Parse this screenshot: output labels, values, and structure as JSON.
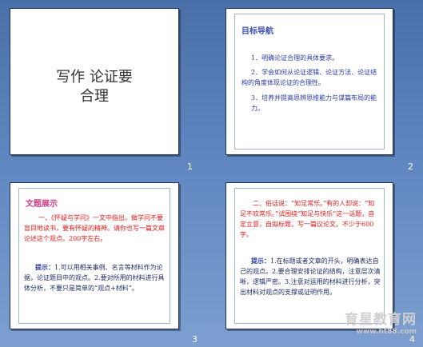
{
  "slides": [
    {
      "number": "1",
      "title_line1": "写作 论证要",
      "title_line2": "合理"
    },
    {
      "number": "2",
      "heading": "目标导航",
      "items": [
        "1．明确论证合理的具体要求。",
        "2．学会如何从论证逻辑、论证方法、论证结构的角度体现论证的合理性。",
        "3．培养并提高思辨思维能力与谋篇布局的能力。"
      ]
    },
    {
      "number": "3",
      "heading": "文题展示",
      "prompt": "一、《怀疑与学问》一文中指出，做学问不要盲目地读书，要有怀疑的精神。请你也写一篇文章论述这个观点。200字左右。",
      "hint_label": "提示：",
      "hint": "1.可以用相关事例、名言等材料作为论据，论证题目中的观点。2.要对所用的材料进行具体分析，不要只是简单的“观点+材料”。"
    },
    {
      "number": "4",
      "prompt": "二、俗话说：“知足常乐。”有的人却说：“知足不欢常乐。”试围绕“知足与快乐”这一话题，自定立意，自拟标题，写一篇议论文。不少于600字。",
      "hint_label": "提示：",
      "hint": "1.在标题或者文章的开头，明确表达自己的观点。2.要合理安排论证的结构，注意层次清晰，逻辑严密。3.注意对运用的材料进行分析，突出材料对观点的支撑或证明作用。"
    }
  ],
  "watermark": {
    "line1": "育星教育网",
    "line2": "www.ht88.com"
  }
}
